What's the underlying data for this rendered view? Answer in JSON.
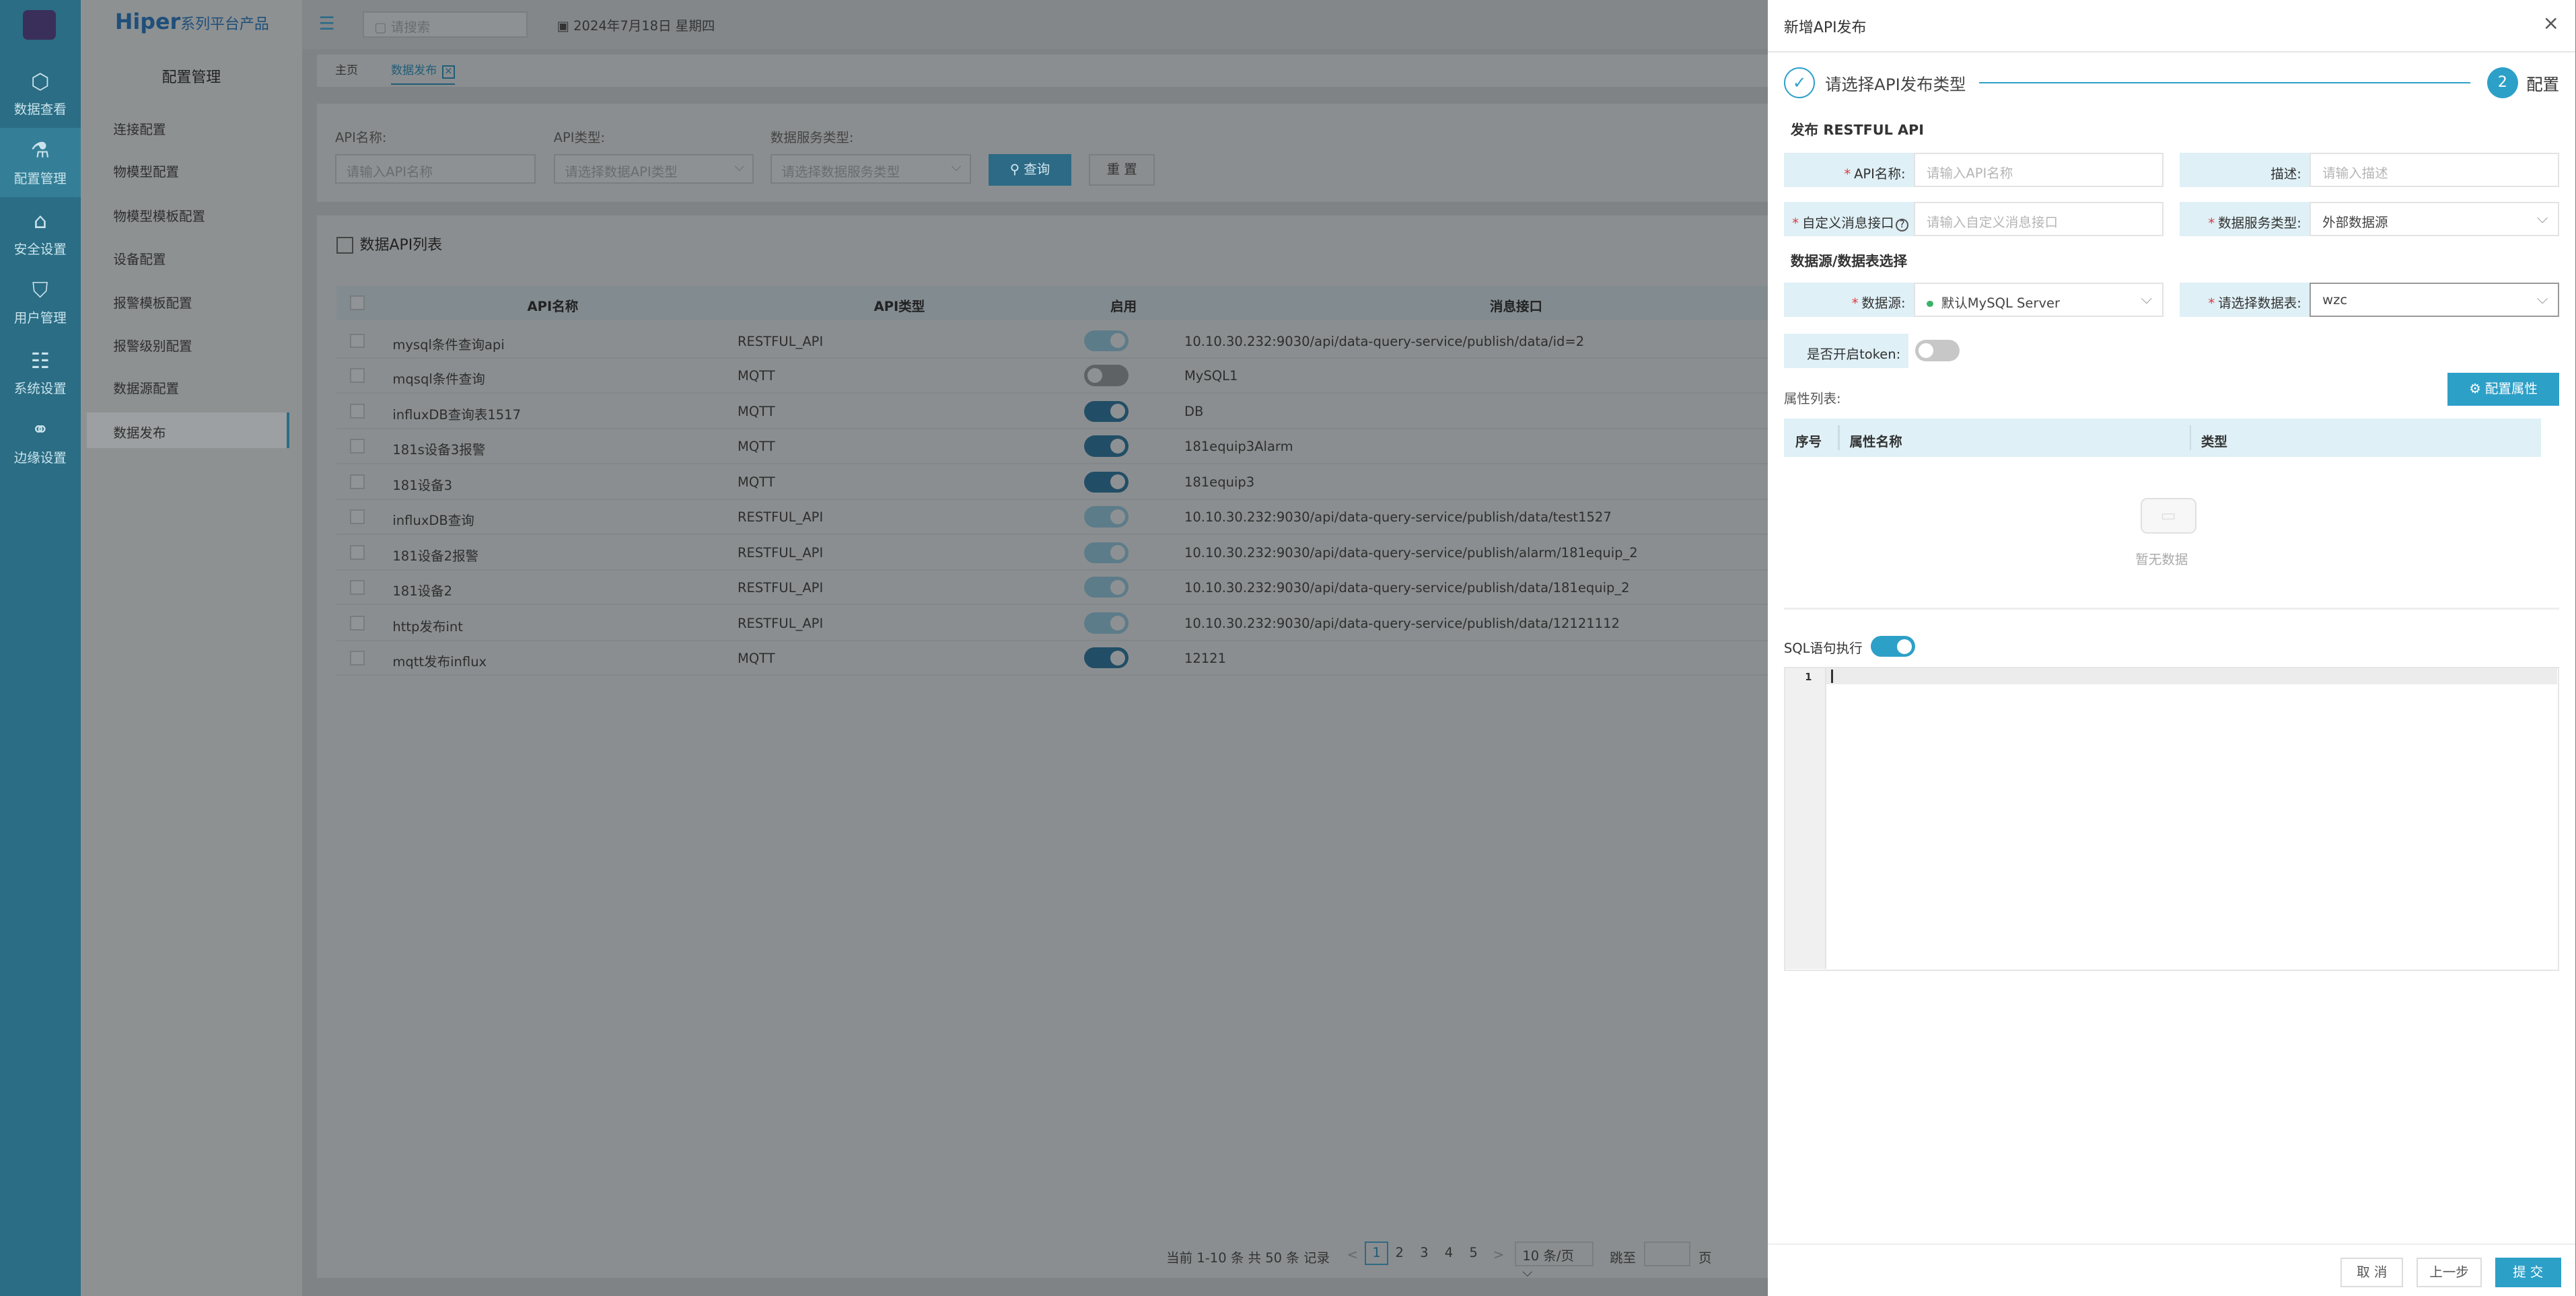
{
  "nav": {
    "items": [
      {
        "label": "数据查看",
        "icon": "cube-icon"
      },
      {
        "label": "配置管理",
        "icon": "flask-icon"
      },
      {
        "label": "安全设置",
        "icon": "home-shield-icon"
      },
      {
        "label": "用户管理",
        "icon": "user-shield-icon"
      },
      {
        "label": "系统设置",
        "icon": "grid-settings-icon"
      },
      {
        "label": "边缘设置",
        "icon": "edge-nodes-icon"
      }
    ]
  },
  "brand": {
    "name": "Hiper",
    "suffix": "系列平台产品"
  },
  "menu": {
    "title": "配置管理",
    "items": [
      "连接配置",
      "物模型配置",
      "物模型模板配置",
      "设备配置",
      "报警模板配置",
      "报警级别配置",
      "数据源配置",
      "数据发布"
    ]
  },
  "topbar": {
    "search_placeholder": "请搜索",
    "date": "2024年7月18日 星期四"
  },
  "tabs": {
    "home": "主页",
    "active": "数据发布"
  },
  "filter": {
    "api_name_label": "API名称:",
    "api_name_placeholder": "请输入API名称",
    "api_type_label": "API类型:",
    "api_type_placeholder": "请选择数据API类型",
    "service_type_label": "数据服务类型:",
    "service_type_placeholder": "请选择数据服务类型",
    "query_button": "查询",
    "reset_button": "重 置"
  },
  "list": {
    "title": "数据API列表",
    "columns": [
      "API名称",
      "API类型",
      "启用",
      "消息接口"
    ],
    "rows": [
      {
        "name": "mysql条件查询api",
        "type": "RESTFUL_API",
        "enabled": "on-dim",
        "endpoint": "10.10.30.232:9030/api/data-query-service/publish/data/id=2"
      },
      {
        "name": "mqsql条件查询",
        "type": "MQTT",
        "enabled": "off",
        "endpoint": "MySQL1"
      },
      {
        "name": "influxDB查询表1517",
        "type": "MQTT",
        "enabled": "on",
        "endpoint": "DB"
      },
      {
        "name": "181s设备3报警",
        "type": "MQTT",
        "enabled": "on",
        "endpoint": "181equip3Alarm"
      },
      {
        "name": "181设备3",
        "type": "MQTT",
        "enabled": "on",
        "endpoint": "181equip3"
      },
      {
        "name": "influxDB查询",
        "type": "RESTFUL_API",
        "enabled": "on-dim",
        "endpoint": "10.10.30.232:9030/api/data-query-service/publish/data/test1527"
      },
      {
        "name": "181设备2报警",
        "type": "RESTFUL_API",
        "enabled": "on-dim",
        "endpoint": "10.10.30.232:9030/api/data-query-service/publish/alarm/181equip_2"
      },
      {
        "name": "181设备2",
        "type": "RESTFUL_API",
        "enabled": "on-dim",
        "endpoint": "10.10.30.232:9030/api/data-query-service/publish/data/181equip_2"
      },
      {
        "name": "http发布int",
        "type": "RESTFUL_API",
        "enabled": "on-dim",
        "endpoint": "10.10.30.232:9030/api/data-query-service/publish/data/12121112"
      },
      {
        "name": "mqtt发布influx",
        "type": "MQTT",
        "enabled": "on",
        "endpoint": "12121"
      }
    ]
  },
  "pager": {
    "summary": "当前 1-10 条 共 50 条 记录",
    "prev": "<",
    "next": ">",
    "pages": [
      "1",
      "2",
      "3",
      "4",
      "5"
    ],
    "current_page": "1",
    "page_size": "10 条/页",
    "jump_label": "跳至",
    "page_unit": "页"
  },
  "drawer": {
    "title": "新增API发布",
    "close": "×",
    "step1": "请选择API发布类型",
    "step2_num": "2",
    "step2": "配置",
    "section_publish": "发布 RESTFUL API",
    "api_name_label": "API名称:",
    "api_name_placeholder": "请输入API名称",
    "desc_label": "描述:",
    "desc_placeholder": "请输入描述",
    "custom_label": "自定义消息接口",
    "custom_placeholder": "请输入自定义消息接口",
    "service_type_label": "数据服务类型:",
    "service_type_value": "外部数据源",
    "section_source": "数据源/数据表选择",
    "datasource_label": "数据源:",
    "datasource_value": "默认MySQL Server",
    "table_label": "请选择数据表:",
    "table_value": "wzc",
    "token_label": "是否开启token:",
    "attr_label": "属性列表:",
    "config_button": "配置属性",
    "attr_columns": [
      "序号",
      "属性名称",
      "类型"
    ],
    "empty_text": "暂无数据",
    "sql_label": "SQL语句执行",
    "editor_line": "1",
    "cancel_button": "取 消",
    "prev_button": "上一步",
    "submit_button": "提 交"
  },
  "colors": {
    "accent": "#2da0c8",
    "sidebar": "#2a6d84",
    "required": "#e0393e"
  }
}
